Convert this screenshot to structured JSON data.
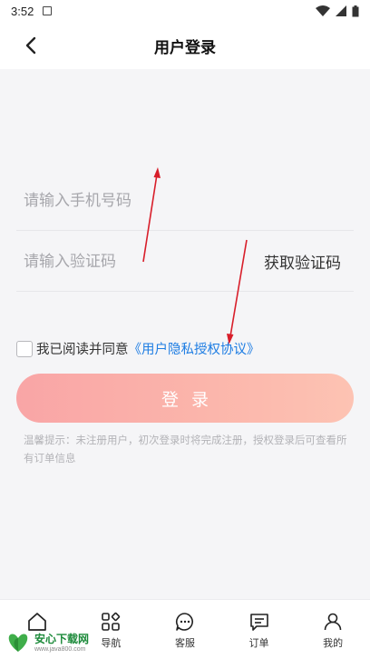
{
  "status_bar": {
    "time": "3:52"
  },
  "header": {
    "title": "用户登录"
  },
  "form": {
    "phone_placeholder": "请输入手机号码",
    "code_placeholder": "请输入验证码",
    "get_code_label": "获取验证码",
    "agree_text": "我已阅读并同意",
    "agree_link": "《用户隐私授权协议》",
    "login_label": "登录",
    "tip": "温馨提示：未注册用户，初次登录时将完成注册，授权登录后可查看所有订单信息"
  },
  "tab_bar": {
    "items": [
      {
        "label": "",
        "icon": "home-icon"
      },
      {
        "label": "导航",
        "icon": "grid-icon"
      },
      {
        "label": "客服",
        "icon": "chat-icon"
      },
      {
        "label": "订单",
        "icon": "order-icon"
      },
      {
        "label": "我的",
        "icon": "user-icon"
      }
    ]
  },
  "watermark": {
    "name": "安心下载网",
    "url": "www.java800.com"
  },
  "colors": {
    "accent_link": "#1e7de3",
    "button_start": "#f9a5a6",
    "button_end": "#fdc3b3",
    "annotation_arrow": "#d81e2a"
  }
}
